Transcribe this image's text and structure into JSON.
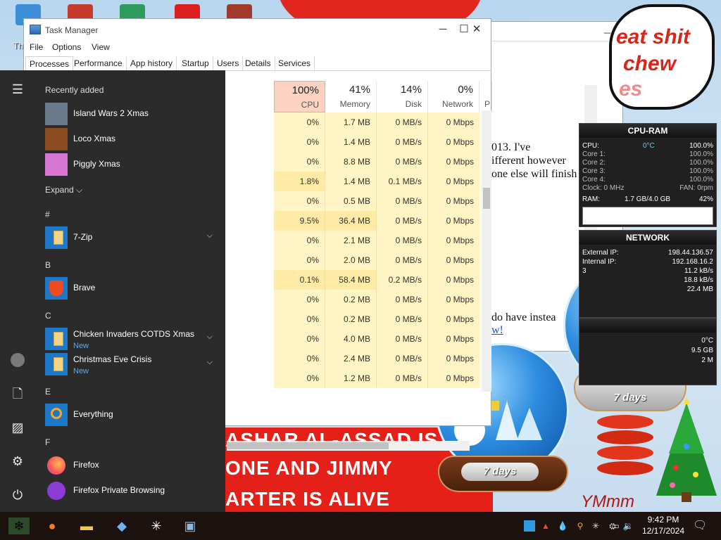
{
  "desktop": {
    "icon_label": "Th",
    "speech_bubble": {
      "line1": "eat shit",
      "line2": "chew",
      "line3": "es"
    },
    "background_window": {
      "text_lines": [
        "013. I've",
        "ifferent however",
        "one else will finish"
      ],
      "text_line2": "do have instea",
      "link_text": "w!"
    },
    "banner": {
      "line1": "ASHAR AL-ASSAD IS",
      "line2": "ONE AND JIMMY",
      "line3": "ARTER IS ALIVE"
    },
    "signature": "YMmm"
  },
  "task_manager": {
    "title": "Task Manager",
    "controls": {
      "minimize": "─",
      "maximize": "☐",
      "close": "✕"
    },
    "menu": [
      "File",
      "Options",
      "View"
    ],
    "tabs": [
      "Processes",
      "Performance",
      "App history",
      "Startup",
      "Users",
      "Details",
      "Services"
    ],
    "columns": [
      {
        "percent": "100%",
        "name": "CPU"
      },
      {
        "percent": "41%",
        "name": "Memory"
      },
      {
        "percent": "14%",
        "name": "Disk"
      },
      {
        "percent": "0%",
        "name": "Network"
      },
      {
        "percent": "",
        "name": "P"
      }
    ],
    "rows": [
      [
        "0%",
        "1.7 MB",
        "0 MB/s",
        "0 Mbps"
      ],
      [
        "0%",
        "1.4 MB",
        "0 MB/s",
        "0 Mbps"
      ],
      [
        "0%",
        "8.8 MB",
        "0 MB/s",
        "0 Mbps"
      ],
      [
        "1.8%",
        "1.4 MB",
        "0.1 MB/s",
        "0 Mbps"
      ],
      [
        "0%",
        "0.5 MB",
        "0 MB/s",
        "0 Mbps"
      ],
      [
        "9.5%",
        "36.4 MB",
        "0 MB/s",
        "0 Mbps"
      ],
      [
        "0%",
        "2.1 MB",
        "0 MB/s",
        "0 Mbps"
      ],
      [
        "0%",
        "2.0 MB",
        "0 MB/s",
        "0 Mbps"
      ],
      [
        "0.1%",
        "58.4 MB",
        "0.2 MB/s",
        "0 Mbps"
      ],
      [
        "0%",
        "0.2 MB",
        "0 MB/s",
        "0 Mbps"
      ],
      [
        "0%",
        "0.2 MB",
        "0 MB/s",
        "0 Mbps"
      ],
      [
        "0%",
        "4.0 MB",
        "0 MB/s",
        "0 Mbps"
      ],
      [
        "0%",
        "2.4 MB",
        "0 MB/s",
        "0 Mbps"
      ],
      [
        "0%",
        "1.2 MB",
        "0 MB/s",
        "0 Mbps"
      ]
    ]
  },
  "start_menu": {
    "recently_added_label": "Recently added",
    "recent": [
      {
        "label": "Island Wars 2 Xmas",
        "color": "#6a7a8c"
      },
      {
        "label": "Loco Xmas",
        "color": "#8a4a22"
      },
      {
        "label": "Piggly Xmas",
        "color": "#d875d2"
      }
    ],
    "expand_label": "Expand",
    "groups": [
      {
        "letter": "#",
        "items": [
          {
            "label": "7-Zip",
            "sub": "",
            "icon": "folder"
          }
        ]
      },
      {
        "letter": "B",
        "items": [
          {
            "label": "Brave",
            "sub": "",
            "icon": "brave"
          }
        ]
      },
      {
        "letter": "C",
        "items": [
          {
            "label": "Chicken Invaders COTDS Xmas",
            "sub": "New",
            "icon": "folder"
          },
          {
            "label": "Christmas Eve Crisis",
            "sub": "New",
            "icon": "folder"
          }
        ]
      },
      {
        "letter": "E",
        "items": [
          {
            "label": "Everything",
            "sub": "",
            "icon": "search"
          }
        ]
      },
      {
        "letter": "F",
        "items": [
          {
            "label": "Firefox",
            "sub": "",
            "icon": "firefox"
          },
          {
            "label": "Firefox Private Browsing",
            "sub": "",
            "icon": "firefox-private"
          }
        ]
      }
    ],
    "rail_icons": [
      "hamburger-icon",
      "user-icon",
      "document-icon",
      "pictures-icon",
      "settings-icon",
      "power-icon"
    ]
  },
  "gadget_cpu": {
    "title": "CPU-RAM",
    "rows": [
      {
        "label": "CPU:",
        "mid": "0°C",
        "value": "100.0%"
      },
      {
        "label": "Core 1:",
        "mid": "",
        "value": "100.0%"
      },
      {
        "label": "Core 2:",
        "mid": "",
        "value": "100.0%"
      },
      {
        "label": "Core 3:",
        "mid": "",
        "value": "100.0%"
      },
      {
        "label": "Core 4:",
        "mid": "",
        "value": "100.0%"
      },
      {
        "label": "Clock: 0 MHz",
        "mid": "",
        "value": "FAN: 0rpm"
      },
      {
        "label": "RAM:",
        "mid": "1.7 GB/4.0 GB",
        "value": "42%"
      }
    ]
  },
  "gadget_network": {
    "title": "NETWORK",
    "rows": [
      {
        "label": "External IP:",
        "value": "198.44.136.57"
      },
      {
        "label": "Internal IP:",
        "value": "192.168.16.2"
      },
      {
        "label": "3",
        "value": "11.2 kB/s"
      },
      {
        "label": "",
        "value": "18.8 kB/s"
      },
      {
        "label": "",
        "value": "22.4 MB"
      }
    ]
  },
  "gadget_third": {
    "temp": "0°C",
    "value": "9.5 GB",
    "value2": "2 M"
  },
  "globes": {
    "left_days": "7 days",
    "right_days": "7 days"
  },
  "taskbar": {
    "time": "9:42 PM",
    "date": "12/17/2024"
  },
  "colors": {
    "cpu_header": "#fcd3c3",
    "heat_column": "#fff4c4",
    "heat_column_hi": "#ffeaa6",
    "start_bg": "#2b2b2b",
    "accent_blue": "#1e78c8"
  }
}
